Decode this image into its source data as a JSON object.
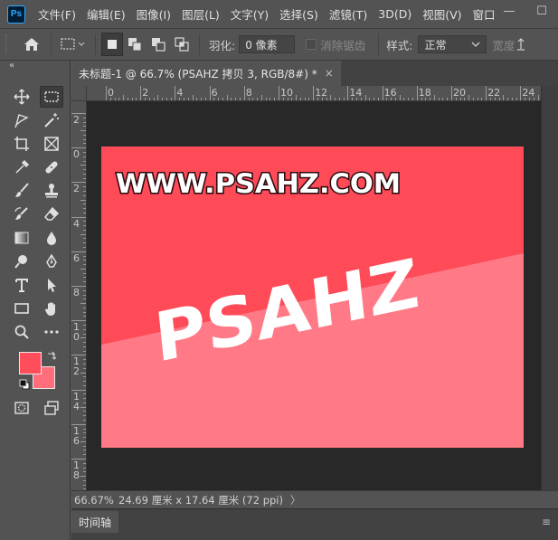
{
  "app": {
    "logo": "Ps"
  },
  "menu": [
    "文件(F)",
    "编辑(E)",
    "图像(I)",
    "图层(L)",
    "文字(Y)",
    "选择(S)",
    "滤镜(T)",
    "3D(D)",
    "视图(V)",
    "窗口"
  ],
  "window_controls": {
    "minimize": "—",
    "maximize": "☐"
  },
  "options": {
    "feather_label": "羽化:",
    "feather_value": "0 像素",
    "antialias_label": "消除锯齿",
    "style_label": "样式:",
    "style_value": "正常",
    "width_label": "宽度"
  },
  "toolbar": {
    "collapse": "«"
  },
  "document": {
    "tab_title": "未标题-1 @ 66.7% (PSAHZ 拷贝 3, RGB/8#) *",
    "close": "×"
  },
  "ruler_h": [
    "0",
    "2",
    "4",
    "6",
    "8",
    "10",
    "12",
    "14",
    "16",
    "18",
    "20",
    "22",
    "24"
  ],
  "ruler_v": [
    "2",
    "0",
    "2",
    "4",
    "6",
    "8",
    "1\n0",
    "1\n2",
    "1\n4",
    "1\n6",
    "1\n8"
  ],
  "artboard": {
    "top_text": "WWW.PSAHZ.COM",
    "main_text": "PSAHZ",
    "color_dark": "#ff4a58",
    "color_light": "#ff7a86"
  },
  "colors": {
    "foreground": "#ff4d5c",
    "background": "#ff6e7a"
  },
  "status": {
    "zoom": "66.67%",
    "doc_info": "24.69 厘米 x 17.64 厘米 (72 ppi)",
    "arrow": "〉"
  },
  "timeline": {
    "tab": "时间轴",
    "menu": "≡"
  }
}
